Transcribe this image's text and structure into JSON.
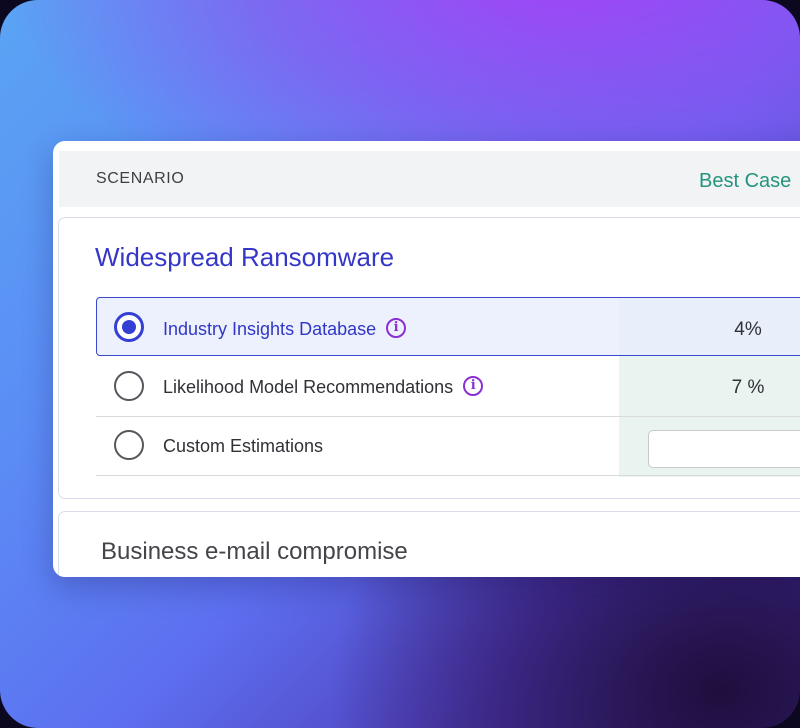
{
  "header": {
    "scenario_label": "SCENARIO",
    "column_label": "Best Case",
    "column_color": "#23957e"
  },
  "scenarios": [
    {
      "title": "Widespread Ransomware",
      "title_color": "#3537c8",
      "options": [
        {
          "label": "Industry Insights Database",
          "value": "4%",
          "selected": true,
          "has_info": true,
          "info_icon": "info-icon"
        },
        {
          "label": "Likelihood Model Recommendations",
          "value": "7 %",
          "selected": false,
          "has_info": true,
          "info_icon": "info-icon"
        },
        {
          "label": "Custom Estimations",
          "value": "",
          "selected": false,
          "has_info": false,
          "input_value": ""
        }
      ]
    },
    {
      "title": "Business e-mail compromise"
    }
  ],
  "colors": {
    "accent": "#3440d4",
    "info": "#8a2fd4",
    "estimate_column": "#e9f3f0"
  }
}
